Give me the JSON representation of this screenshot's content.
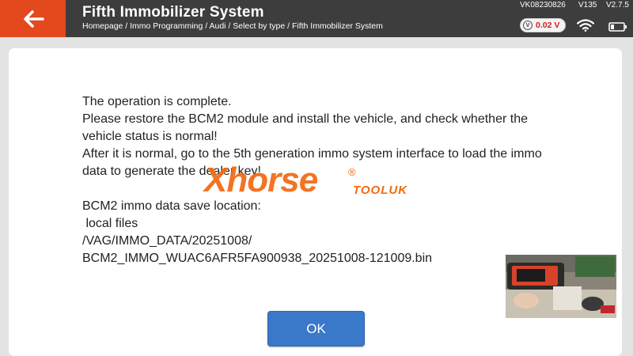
{
  "header": {
    "title": "Fifth Immobilizer System",
    "breadcrumb": "Homepage / Immo Programming / Audi / Select by type / Fifth Immobilizer System",
    "device_id": "VK08230826",
    "version_hw": "V135",
    "version_sw": "V2.7.5",
    "voltage": "0.02 V",
    "icons": [
      "back-arrow-icon",
      "voltage-icon",
      "wifi-icon",
      "battery-icon"
    ]
  },
  "message": {
    "line1": "The operation is complete.",
    "line2": "Please restore the BCM2 module and install the vehicle, and check whether the vehicle status is normal!",
    "line3": "After it is normal, go to the 5th generation immo system interface to load the immo data to generate the dealer key!",
    "line4": "BCM2 immo data save location:",
    "line5": " local files",
    "line6": "/VAG/IMMO_DATA/20251008/",
    "line7": "BCM2_IMMO_WUAC6AFR5FA900938_20251008-121009.bin"
  },
  "dialog": {
    "ok_label": "OK"
  },
  "watermark": {
    "brand": "Xhorse",
    "reg": "®",
    "suffix": "TOOLUK"
  },
  "colors": {
    "accent": "#e4481d",
    "header_bg": "#3d3d3d",
    "button": "#3a78c9",
    "voltage_text": "#d02020",
    "watermark": "#f36a12"
  }
}
